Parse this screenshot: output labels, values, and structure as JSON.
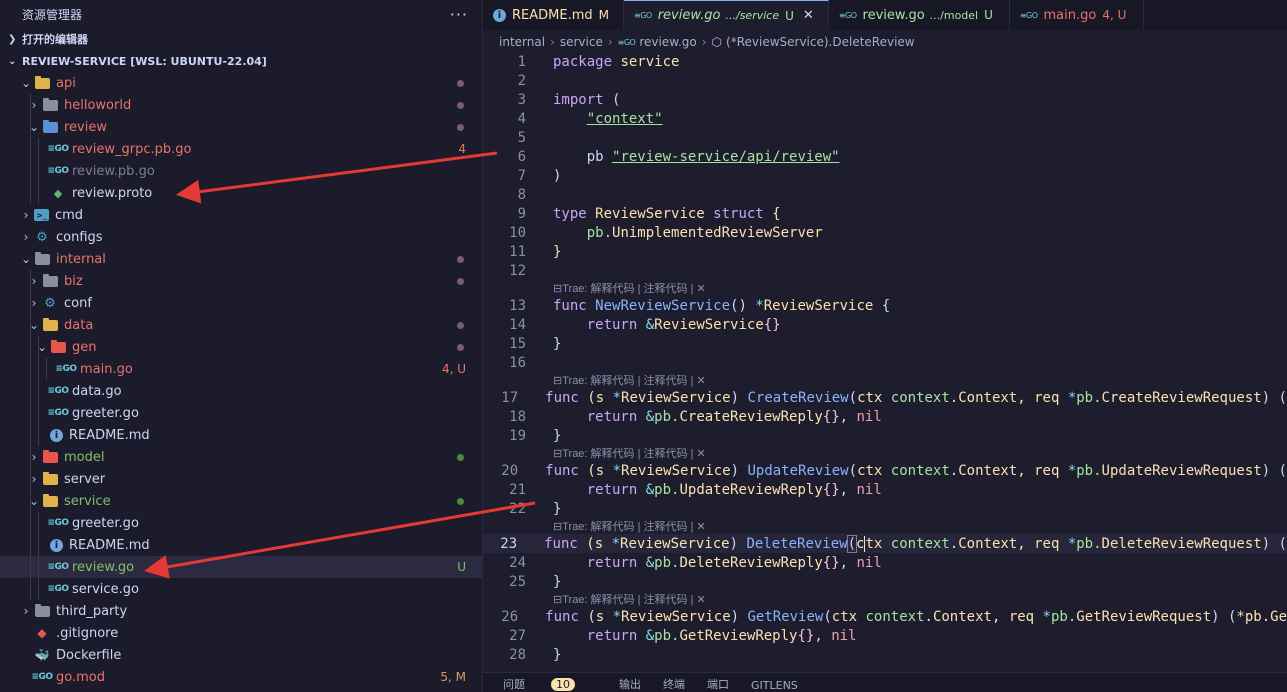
{
  "sidebar": {
    "title": "资源管理器",
    "more": "···",
    "open_editors": "打开的编辑器",
    "workspace": "REVIEW-SERVICE [WSL: UBUNTU-22.04]",
    "tree": [
      {
        "label": "api",
        "badge": "",
        "dot": "red"
      },
      {
        "label": "helloworld",
        "badge": "",
        "dot": "red"
      },
      {
        "label": "review",
        "badge": "",
        "dot": "red"
      },
      {
        "label": "review_grpc.pb.go",
        "badge": "4",
        "dot": ""
      },
      {
        "label": "review.pb.go",
        "badge": "",
        "dot": ""
      },
      {
        "label": "review.proto",
        "badge": "",
        "dot": ""
      },
      {
        "label": "cmd",
        "badge": "",
        "dot": ""
      },
      {
        "label": "configs",
        "badge": "",
        "dot": ""
      },
      {
        "label": "internal",
        "badge": "",
        "dot": "red"
      },
      {
        "label": "biz",
        "badge": "",
        "dot": "red"
      },
      {
        "label": "conf",
        "badge": "",
        "dot": ""
      },
      {
        "label": "data",
        "badge": "",
        "dot": "red"
      },
      {
        "label": "gen",
        "badge": "",
        "dot": "red"
      },
      {
        "label": "main.go",
        "badge": "4, U",
        "dot": ""
      },
      {
        "label": "data.go",
        "badge": "",
        "dot": ""
      },
      {
        "label": "greeter.go",
        "badge": "",
        "dot": ""
      },
      {
        "label": "README.md",
        "badge": "",
        "dot": ""
      },
      {
        "label": "model",
        "badge": "",
        "dot": "green"
      },
      {
        "label": "server",
        "badge": "",
        "dot": ""
      },
      {
        "label": "service",
        "badge": "",
        "dot": "green"
      },
      {
        "label": "greeter.go",
        "badge": "",
        "dot": ""
      },
      {
        "label": "README.md",
        "badge": "",
        "dot": ""
      },
      {
        "label": "review.go",
        "badge": "U",
        "dot": ""
      },
      {
        "label": "service.go",
        "badge": "",
        "dot": ""
      },
      {
        "label": "third_party",
        "badge": "",
        "dot": ""
      },
      {
        "label": ".gitignore",
        "badge": "",
        "dot": ""
      },
      {
        "label": "Dockerfile",
        "badge": "",
        "dot": ""
      },
      {
        "label": "go.mod",
        "badge": "5, M",
        "dot": ""
      }
    ]
  },
  "tabs": [
    {
      "icon": "info-icon",
      "name": "README.md",
      "dir": "",
      "status": "M"
    },
    {
      "icon": "go-icon",
      "name": "review.go",
      "dir": ".../service",
      "status": "U",
      "close": "✕"
    },
    {
      "icon": "go-icon",
      "name": "review.go",
      "dir": ".../model",
      "status": "U"
    },
    {
      "icon": "go-icon",
      "name": "main.go",
      "dir": "",
      "status": "4, U"
    }
  ],
  "breadcrumb": [
    "internal",
    "service",
    "review.go",
    "(*ReviewService).DeleteReview"
  ],
  "editor": {
    "line_numbers": [
      "1",
      "2",
      "3",
      "4",
      "5",
      "6",
      "7",
      "8",
      "9",
      "10",
      "11",
      "12",
      "13",
      "14",
      "15",
      "16",
      "17",
      "18",
      "19",
      "20",
      "21",
      "22",
      "23",
      "24",
      "25",
      "26",
      "27",
      "28"
    ],
    "codelens": "Trae: 解释代码 | 注释代码 | ✕",
    "code": {
      "l1a": "package",
      "l1b": " service",
      "l3a": "import",
      "l3b": " (",
      "l4": "\"context\"",
      "l6a": "pb ",
      "l6b": "\"review-service/api/review\"",
      "l7": ")",
      "l9a": "type ",
      "l9b": "ReviewService",
      "l9c": " struct ",
      "l9d": "{",
      "l10a": "pb.",
      "l10b": "UnimplementedReviewServer",
      "l11": "}",
      "l13a": "func ",
      "l13b": "NewReviewService",
      "l13c": "() ",
      "l13d": "*",
      "l13e": "ReviewService",
      "l13f": " {",
      "l14a": "return ",
      "l14b": "&",
      "l14c": "ReviewService",
      "l14d": "{}",
      "l15": "}",
      "l17a": "func ",
      "l17b": "(s ",
      "l17c": "*",
      "l17d": "ReviewService",
      ") ": ") ",
      "l17e": "CreateReview",
      "l17f": "(",
      "l17g": "ctx ",
      "l17h": "context",
      "l17i": ".Context, ",
      "l17j": "req ",
      "l17k": "*",
      "l17l": "pb.",
      "l17m": "CreateReviewRequest",
      "l17n": ") (",
      "l18a": "return ",
      "l18b": "&",
      "l18c": "pb.",
      "l18d": "CreateReviewReply",
      "l18e": "{}",
      ", nil": ", ",
      "l18f": "nil",
      "l19": "}",
      "l20e": "UpdateReview",
      "l20m": "UpdateReviewRequest",
      "l21d": "UpdateReviewReply",
      "l22": "}",
      "l23e": "DeleteReview",
      "l23g1": "c",
      "l23g2": "tx ",
      "l23m": "DeleteReviewRequest",
      "l24d": "DeleteReviewReply",
      "l25": "}",
      "l26e": "GetReview",
      "l26m": "GetReviewRequest",
      "l26n": ") (",
      "l26o": "*pb.Ge",
      "l27d": "GetReviewReply",
      "l28": "}"
    }
  },
  "panel": {
    "problems": "问题",
    "problems_count": "10",
    "output": "输出",
    "terminal": "终端",
    "ports": "端口",
    "gitlens": "GITLENS"
  },
  "colors": {
    "accent_red": "#e8736b",
    "accent_green": "#7ec26a",
    "arrow": "#e53935",
    "bg": "#1e1d2e"
  }
}
